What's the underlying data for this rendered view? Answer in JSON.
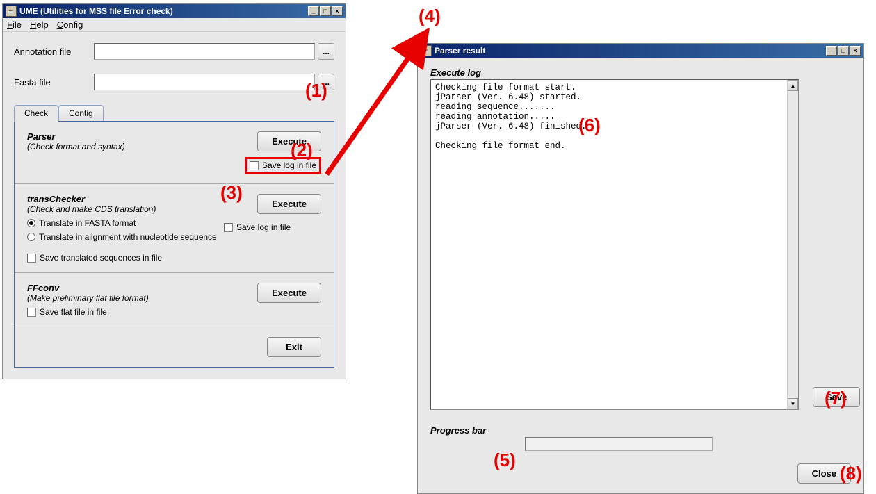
{
  "main_window": {
    "title": "UME (Utilities for MSS file Error check)",
    "menu": {
      "file": "File",
      "help": "Help",
      "config": "Config"
    },
    "annotation_label": "Annotation file",
    "fasta_label": "Fasta  file",
    "browse_label": "...",
    "tabs": {
      "check": "Check",
      "contig": "Contig"
    },
    "parser": {
      "title": "Parser",
      "subtitle": "(Check format and syntax)",
      "execute": "Execute",
      "save_log": "Save log in file"
    },
    "transchecker": {
      "title": "transChecker",
      "subtitle": "(Check and make CDS translation)",
      "execute": "Execute",
      "save_log": "Save log in file",
      "radio1": "Translate in FASTA format",
      "radio2": "Translate in alignment with nucleotide sequence",
      "save_translated": "Save translated sequences in file"
    },
    "ffconv": {
      "title": "FFconv",
      "subtitle": "(Make preliminary flat file format)",
      "execute": "Execute",
      "save_flat": "Save flat file in file"
    },
    "exit_label": "Exit"
  },
  "parser_window": {
    "title": "Parser result",
    "execute_log_label": "Execute log",
    "log_text": "Checking file format start.\njParser (Ver. 6.48) started.\nreading sequence.......\nreading annotation.....\njParser (Ver. 6.48) finished.\n\nChecking file format end.",
    "save_label": "Save",
    "progress_label": "Progress bar",
    "close_label": "Close"
  },
  "annotations": {
    "a1": "(1)",
    "a2": "(2)",
    "a3": "(3)",
    "a4": "(4)",
    "a5": "(5)",
    "a6": "(6)",
    "a7": "(7)",
    "a8": "(8)"
  }
}
